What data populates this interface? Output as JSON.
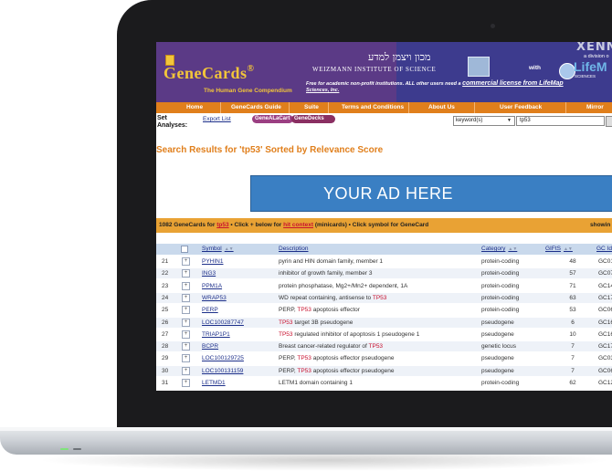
{
  "header": {
    "logo": "GeneCards",
    "logo_reg": "®",
    "logo_subtitle": "The Human Gene Compendium",
    "hebrew": "מכון ויצמן למדע",
    "weizmann": "WEIZMANN INSTITUTE OF SCIENCE",
    "with": "with",
    "xenn": "XENN",
    "division": "a division o",
    "lifemap": "LifeM",
    "sciences": "SCIENCES",
    "free_text": "Free for academic non-profit institutions.  ALL other users need a ",
    "license_link": "commercial license from LifeMap",
    "sciences_inc": "Sciences, Inc."
  },
  "nav": {
    "items": [
      "Home",
      "GeneCards Guide",
      "Suite",
      "Terms and Conditions",
      "About Us",
      "User Feedback",
      "Mirror"
    ]
  },
  "tools": {
    "set_analyses": "Set Analyses:",
    "export_list": "Export List",
    "genealacart": "GeneALaCart",
    "genedecks": "GeneDecks",
    "search_field_select": "keyword(s)",
    "search_query": "tp53"
  },
  "results_title": "Search Results for 'tp53' Sorted by Relevance Score",
  "ad": {
    "text": "YOUR AD HERE"
  },
  "count_bar": {
    "prefix": "1082 GeneCards for ",
    "query": "tp53",
    "middle": "  • Click + below for ",
    "hit_context": "hit context",
    "suffix": " (minicards)   • Click symbol for GeneCard",
    "showing": "showin"
  },
  "table": {
    "headers": {
      "symbol": "Symbol",
      "description": "Description",
      "category": "Category",
      "gifts": "GIFtS",
      "gcid": "GC Id"
    },
    "rows": [
      {
        "n": "21",
        "symbol": "PYHIN1",
        "d1": "pyrin and HIN domain family, member 1",
        "tp": "",
        "d2": "",
        "cat": "protein-coding",
        "gifts": "48",
        "gcid": "GC01"
      },
      {
        "n": "22",
        "symbol": "ING3",
        "d1": "inhibitor of growth family, member 3",
        "tp": "",
        "d2": "",
        "cat": "protein-coding",
        "gifts": "57",
        "gcid": "GC07"
      },
      {
        "n": "23",
        "symbol": "PPM1A",
        "d1": "protein phosphatase, Mg2+/Mn2+ dependent, 1A",
        "tp": "",
        "d2": "",
        "cat": "protein-coding",
        "gifts": "71",
        "gcid": "GC14"
      },
      {
        "n": "24",
        "symbol": "WRAP53",
        "d1": "WD repeat containing, antisense to ",
        "tp": "TP53",
        "d2": "",
        "cat": "protein-coding",
        "gifts": "63",
        "gcid": "GC17"
      },
      {
        "n": "25",
        "symbol": "PERP",
        "d1": "PERP, ",
        "tp": "TP53",
        "d2": " apoptosis effector",
        "cat": "protein-coding",
        "gifts": "53",
        "gcid": "GC06"
      },
      {
        "n": "26",
        "symbol": "LOC100287747",
        "d1": "",
        "tp": "TP53",
        "d2": " target 3B pseudogene",
        "cat": "pseudogene",
        "gifts": "6",
        "gcid": "GC16"
      },
      {
        "n": "27",
        "symbol": "TRIAP1P1",
        "d1": "",
        "tp": "TP53",
        "d2": " regulated inhibitor of apoptosis 1 pseudogene 1",
        "cat": "pseudogene",
        "gifts": "10",
        "gcid": "GC16"
      },
      {
        "n": "28",
        "symbol": "BCPR",
        "d1": "Breast cancer-related regulator of ",
        "tp": "TP53",
        "d2": "",
        "cat": "genetic locus",
        "gifts": "7",
        "gcid": "GC17"
      },
      {
        "n": "29",
        "symbol": "LOC100129725",
        "d1": "PERP, ",
        "tp": "TP53",
        "d2": " apoptosis effector pseudogene",
        "cat": "pseudogene",
        "gifts": "7",
        "gcid": "GC03"
      },
      {
        "n": "30",
        "symbol": "LOC100131159",
        "d1": "PERP, ",
        "tp": "TP53",
        "d2": " apoptosis effector pseudogene",
        "cat": "pseudogene",
        "gifts": "7",
        "gcid": "GC06"
      },
      {
        "n": "31",
        "symbol": "LETMD1",
        "d1": "LETM1 domain containing 1",
        "tp": "",
        "d2": "",
        "cat": "protein-coding",
        "gifts": "62",
        "gcid": "GC12"
      }
    ]
  },
  "colors": {
    "header_purple": "#5b3a86",
    "nav_orange": "#e07f1c",
    "count_orange": "#e9a234",
    "ad_blue": "#3a7fc3",
    "link_blue": "#1c2f8a",
    "highlight_red": "#c8102e"
  }
}
